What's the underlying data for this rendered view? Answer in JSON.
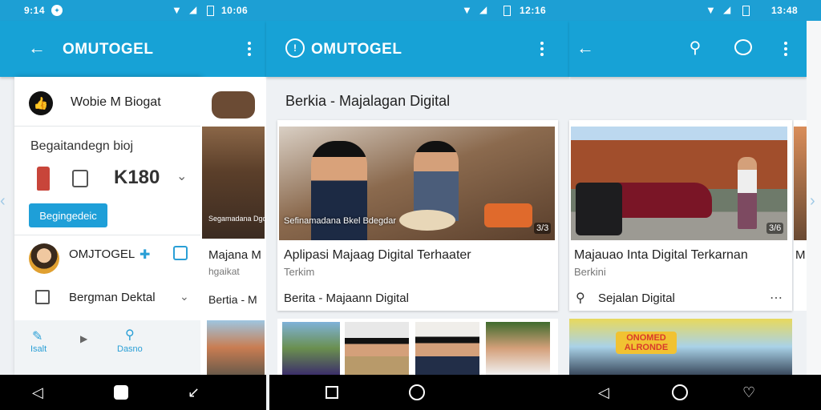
{
  "colors": {
    "accent": "#17a2d6",
    "button": "#1e9fd8",
    "icon_blue": "#2a9fd6"
  },
  "left": {
    "status_time": "9:14",
    "status_right": "10:06",
    "app_title": "OMUTOGEL",
    "drawer_header": "Wobie M Biogat",
    "section_title": "Begaitandegn bioj",
    "stat_value": "K180",
    "button_label": "Begingedeic",
    "profile_name": "OMJTOGEL",
    "menu_item": "Bergman Dektal",
    "bottom_left_label": "Isalt",
    "bottom_right_label": "Dasno",
    "peek_title": "Majana M",
    "peek_subtitle": "hgaikat",
    "peek_label": "Bertia - M",
    "peek_caption": "Segamadana Dgdak"
  },
  "middle": {
    "status_time": "12:16",
    "app_title": "OMUTOGEL",
    "page_title": "Berkia - Majalagan Digital",
    "photo_caption": "Sefinamadana Bkel Bdegdar",
    "photo_badge": "3/3",
    "card_title": "Aplipasi Majaag Digital Terhaater",
    "card_subtitle": "Terkim",
    "section_label": "Berita - Majaann Digital"
  },
  "right": {
    "status_time": "13:48",
    "card_title": "Majauao Inta Digital Terkarnan",
    "card_subtitle": "Berkini",
    "section_label": "Sejalan Digital",
    "photo_badge": "3/6",
    "peek_title": "M",
    "sign_text": "ONOMED ALRONDE"
  }
}
